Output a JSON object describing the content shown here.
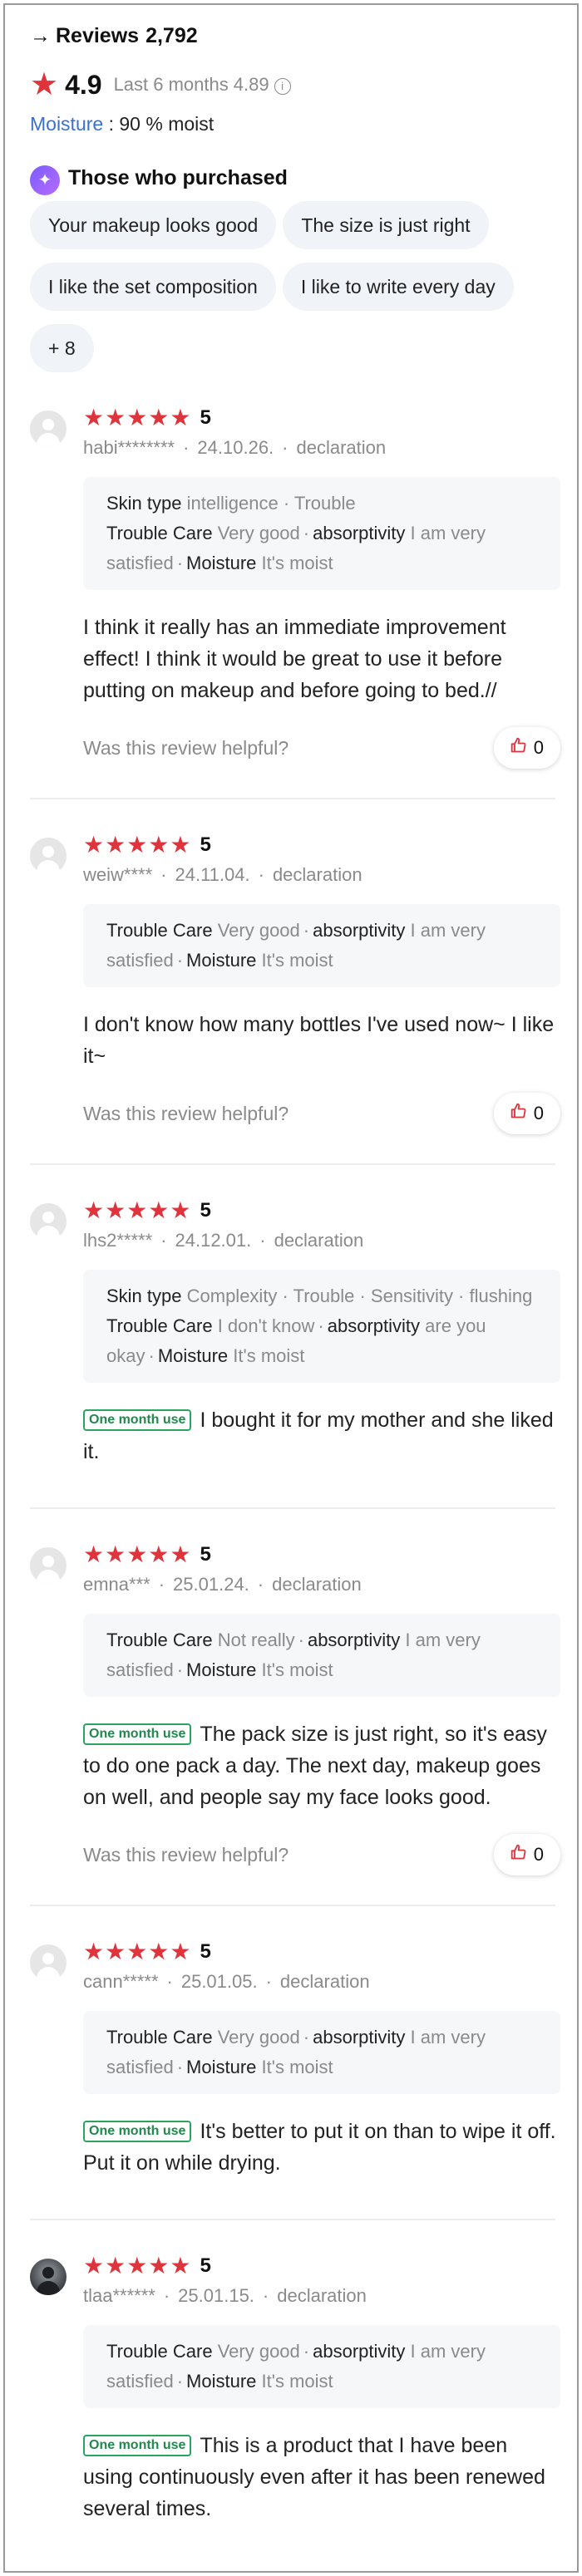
{
  "header": {
    "arrow": "→",
    "reviews_label": "Reviews",
    "reviews_count": "2,792"
  },
  "rating": {
    "score": "4.9",
    "last_label": "Last 6 months",
    "last_score": "4.89",
    "info_glyph": "i",
    "accent_color": "#e0343d"
  },
  "moisture": {
    "key": "Moisture",
    "value": " : 90 % moist"
  },
  "purchased": {
    "title": "Those who purchased",
    "chips": [
      "Your makeup looks good",
      "The size is just right",
      "I like the set composition",
      "I like to write every day",
      "+ 8"
    ]
  },
  "common": {
    "stars": "★★★★★",
    "helpful_question": "Was this review helpful?",
    "badge": "One month use",
    "dot": "·"
  },
  "reviews": [
    {
      "score": "5",
      "user": "habi********",
      "date": "24.10.26.",
      "source": "declaration",
      "attrs": [
        {
          "k": "Skin type",
          "v": "intelligence · Trouble"
        },
        {
          "k": "Trouble Care",
          "v": "Very good"
        },
        {
          "k": "absorptivity",
          "v": "I am very satisfied"
        },
        {
          "k": "Moisture",
          "v": "It's moist"
        }
      ],
      "text": "I think it really has an immediate improvement effect! I think it would be great to use it before putting on makeup and before going to bed.//",
      "likes": "0"
    },
    {
      "score": "5",
      "user": "weiw****",
      "date": "24.11.04.",
      "source": "declaration",
      "attrs": [
        {
          "k": "Trouble Care",
          "v": "Very good"
        },
        {
          "k": "absorptivity",
          "v": "I am very satisfied"
        },
        {
          "k": "Moisture",
          "v": "It's moist"
        }
      ],
      "text": "I don't know how many bottles I've used now~ I like it~",
      "likes": "0"
    },
    {
      "score": "5",
      "user": "lhs2*****",
      "date": "24.12.01.",
      "source": "declaration",
      "attrs": [
        {
          "k": "Skin type",
          "v": "Complexity · Trouble · Sensitivity · flushing"
        },
        {
          "k": "Trouble Care",
          "v": "I don't know"
        },
        {
          "k": "absorptivity",
          "v": "are you okay"
        },
        {
          "k": "Moisture",
          "v": "It's moist"
        }
      ],
      "text": "I bought it for my mother and she liked it."
    },
    {
      "score": "5",
      "user": "emna***",
      "date": "25.01.24.",
      "source": "declaration",
      "attrs": [
        {
          "k": "Trouble Care",
          "v": "Not really"
        },
        {
          "k": "absorptivity",
          "v": "I am very satisfied"
        },
        {
          "k": "Moisture",
          "v": "It's moist"
        }
      ],
      "text": "The pack size is just right, so it's easy to do one pack a day. The next day, makeup goes on well, and people say my face looks good.",
      "likes": "0"
    },
    {
      "score": "5",
      "user": "cann*****",
      "date": "25.01.05.",
      "source": "declaration",
      "attrs": [
        {
          "k": "Trouble Care",
          "v": "Very good"
        },
        {
          "k": "absorptivity",
          "v": "I am very satisfied"
        },
        {
          "k": "Moisture",
          "v": "It's moist"
        }
      ],
      "text": "It's better to put it on than to wipe it off. Put it on while drying."
    },
    {
      "score": "5",
      "user": "tlaa******",
      "date": "25.01.15.",
      "source": "declaration",
      "attrs": [
        {
          "k": "Trouble Care",
          "v": "Very good"
        },
        {
          "k": "absorptivity",
          "v": "I am very satisfied"
        },
        {
          "k": "Moisture",
          "v": "It's moist"
        }
      ],
      "text": "This is a product that I have been using continuously even after it has been renewed several times."
    }
  ]
}
